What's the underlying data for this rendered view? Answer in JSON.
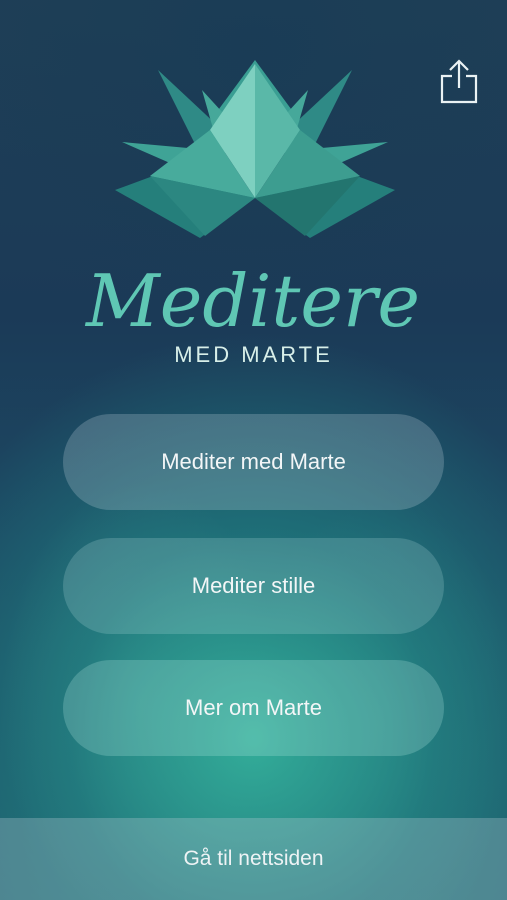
{
  "header": {
    "share_icon": "share-icon"
  },
  "brand": {
    "logo_icon": "lotus-icon",
    "title": "Meditere",
    "subtitle": "MED MARTE",
    "accent_color": "#5fc7b4"
  },
  "menu": {
    "items": [
      {
        "label": "Mediter med Marte"
      },
      {
        "label": "Mediter stille"
      },
      {
        "label": "Mer om Marte"
      }
    ]
  },
  "footer": {
    "link_label": "Gå til nettsiden"
  }
}
